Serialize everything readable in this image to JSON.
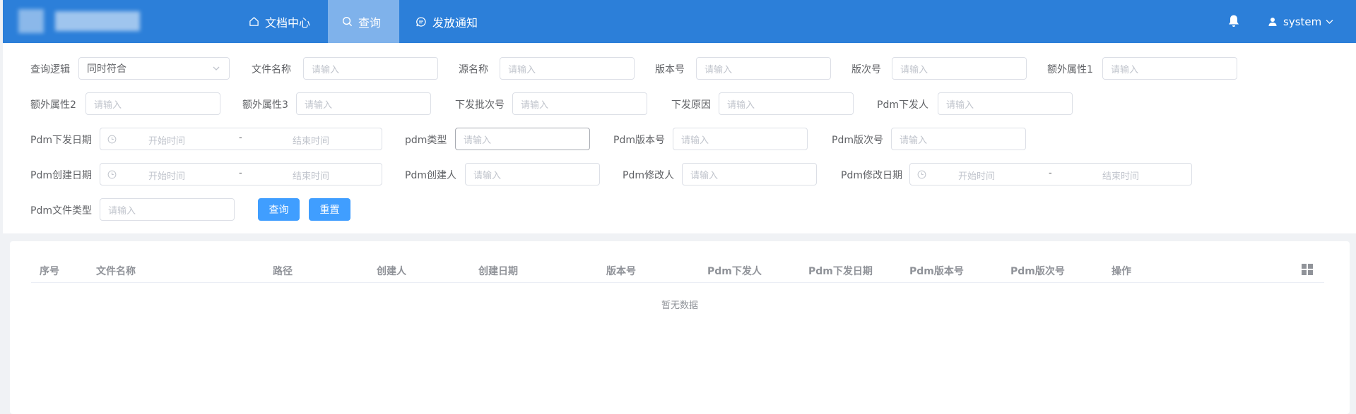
{
  "header": {
    "nav": [
      {
        "label": "文档中心",
        "icon": "home-icon"
      },
      {
        "label": "查询",
        "icon": "search-icon",
        "active": true
      },
      {
        "label": "发放通知",
        "icon": "message-icon"
      }
    ],
    "user": "system",
    "colors": {
      "bar": "#2c7fd9",
      "active": "#7fb2eb"
    }
  },
  "search": {
    "logic": {
      "label": "查询逻辑",
      "value": "同时符合"
    },
    "file_name": {
      "label": "文件名称",
      "placeholder": "请输入"
    },
    "source_name": {
      "label": "源名称",
      "placeholder": "请输入"
    },
    "version_no": {
      "label": "版本号",
      "placeholder": "请输入"
    },
    "revision_no": {
      "label": "版次号",
      "placeholder": "请输入"
    },
    "extra1": {
      "label": "额外属性1",
      "placeholder": "请输入"
    },
    "extra2": {
      "label": "额外属性2",
      "placeholder": "请输入"
    },
    "extra3": {
      "label": "额外属性3",
      "placeholder": "请输入"
    },
    "batch_no": {
      "label": "下发批次号",
      "placeholder": "请输入"
    },
    "reason": {
      "label": "下发原因",
      "placeholder": "请输入"
    },
    "pdm_sender": {
      "label": "Pdm下发人",
      "placeholder": "请输入"
    },
    "pdm_send_date": {
      "label": "Pdm下发日期",
      "start": "开始时间",
      "sep": "-",
      "end": "结束时间"
    },
    "pdm_type": {
      "label": "pdm类型",
      "placeholder": "请输入"
    },
    "pdm_version": {
      "label": "Pdm版本号",
      "placeholder": "请输入"
    },
    "pdm_revision": {
      "label": "Pdm版次号",
      "placeholder": "请输入"
    },
    "pdm_create_date": {
      "label": "Pdm创建日期",
      "start": "开始时间",
      "sep": "-",
      "end": "结束时间"
    },
    "pdm_creator": {
      "label": "Pdm创建人",
      "placeholder": "请输入"
    },
    "pdm_modifier": {
      "label": "Pdm修改人",
      "placeholder": "请输入"
    },
    "pdm_modify_date": {
      "label": "Pdm修改日期",
      "start": "开始时间",
      "sep": "-",
      "end": "结束时间"
    },
    "pdm_file_type": {
      "label": "Pdm文件类型",
      "placeholder": "请输入"
    },
    "query_button": "查询",
    "reset_button": "重置"
  },
  "table": {
    "columns": [
      "序号",
      "文件名称",
      "路径",
      "创建人",
      "创建日期",
      "版本号",
      "Pdm下发人",
      "Pdm下发日期",
      "Pdm版本号",
      "Pdm版次号",
      "操作"
    ],
    "empty_text": "暂无数据"
  }
}
